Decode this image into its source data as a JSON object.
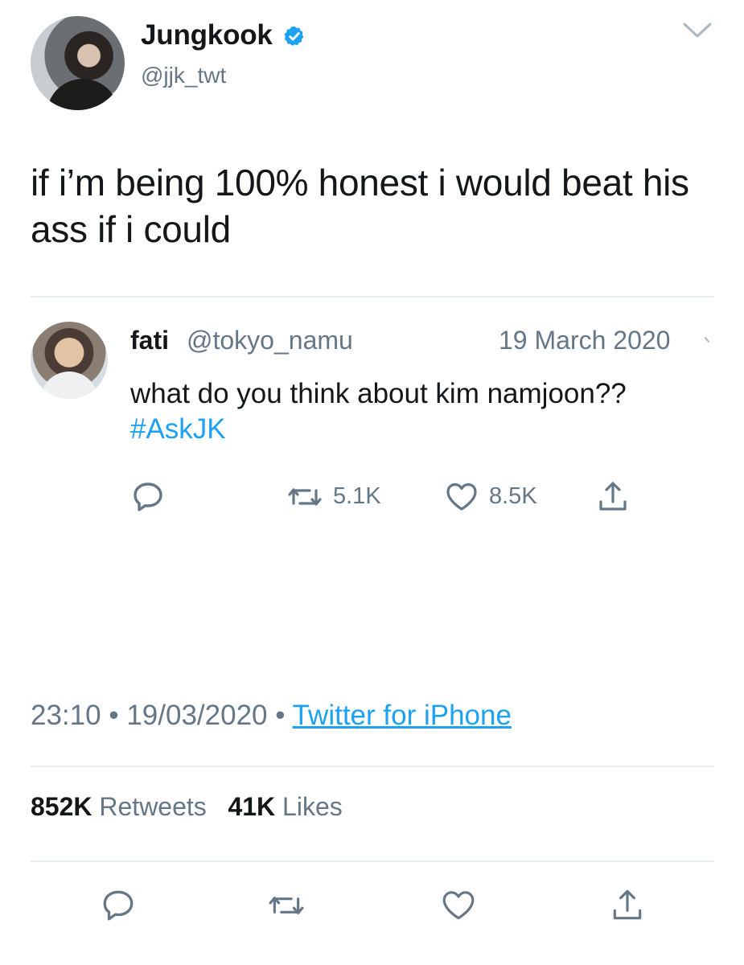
{
  "author": {
    "display_name": "Jungkook",
    "handle": "@jjk_twt",
    "verified": true,
    "icons": [
      "verified-badge-icon",
      "chevron-down-icon"
    ]
  },
  "tweet": {
    "text": "if i’m being 100% honest i would beat his ass if i could"
  },
  "quoted_tweet": {
    "name": "fati",
    "handle": "@tokyo_namu",
    "date": "19 March 2020",
    "text": "what do you think about kim namjoon??",
    "hashtag": "#AskJK",
    "retweets": "5.1K",
    "likes": "8.5K",
    "icons": [
      "reply-icon",
      "retweet-icon",
      "like-icon",
      "share-icon"
    ]
  },
  "meta": {
    "time": "23:10",
    "separator": "•",
    "date": "19/03/2020",
    "source": "Twitter for iPhone"
  },
  "stats": {
    "retweets_count": "852K",
    "retweets_label": "Retweets",
    "likes_count": "41K",
    "likes_label": "Likes"
  },
  "colors": {
    "link_blue": "#1da1f2",
    "secondary_gray": "#657786",
    "divider": "#e6ecf0"
  }
}
